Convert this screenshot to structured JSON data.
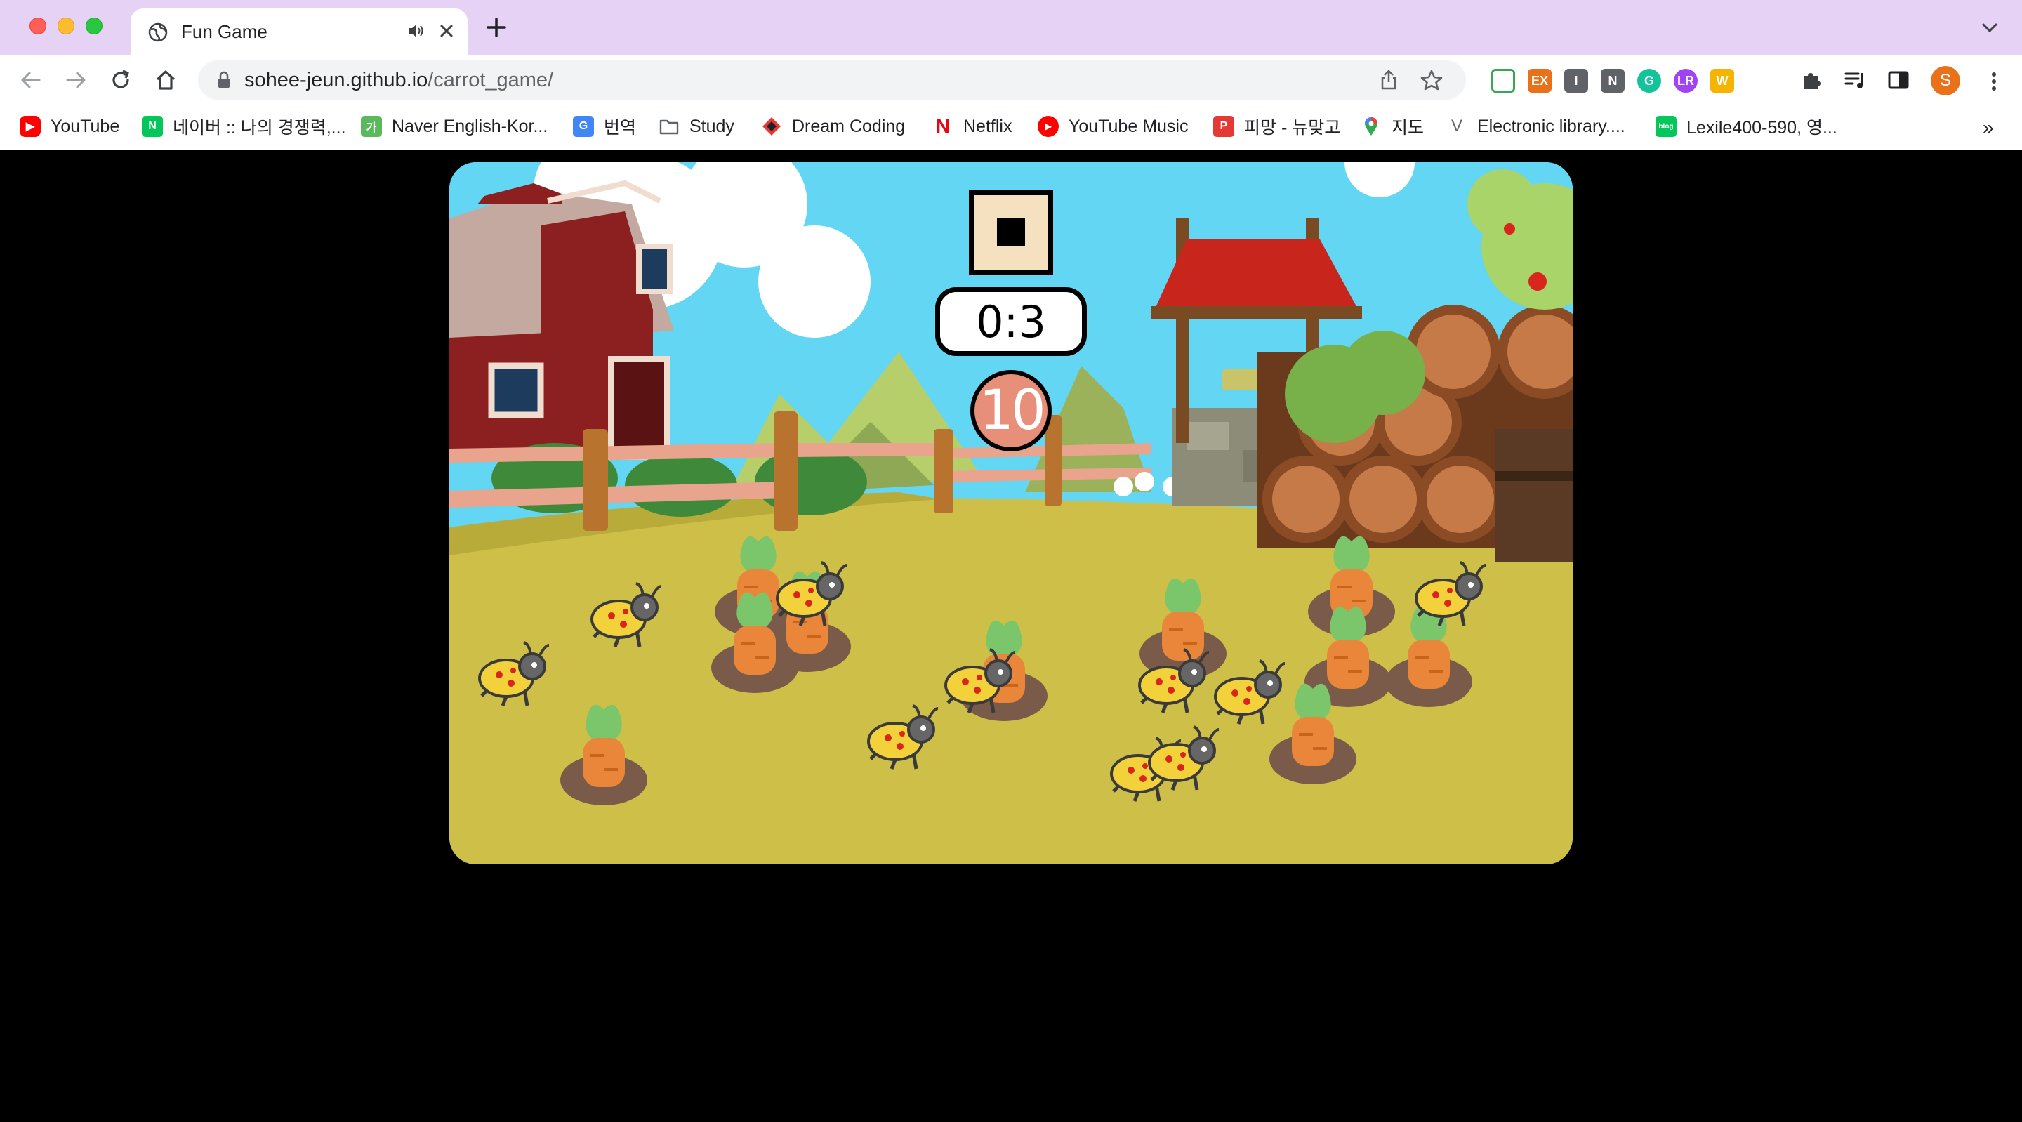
{
  "browser": {
    "tab": {
      "title": "Fun Game"
    },
    "url": {
      "host": "sohee-jeun.github.io",
      "path": "/carrot_game/"
    },
    "bookmarks": [
      {
        "label": "YouTube",
        "icon": "youtube-icon"
      },
      {
        "label": "네이버 :: 나의 경쟁력,...",
        "icon": "naver-icon"
      },
      {
        "label": "Naver English-Kor...",
        "icon": "naver-dictionary-icon"
      },
      {
        "label": "번역",
        "icon": "google-translate-icon"
      },
      {
        "label": "Study",
        "icon": "folder-icon"
      },
      {
        "label": "Dream Coding",
        "icon": "dream-coding-icon"
      },
      {
        "label": "Netflix",
        "icon": "netflix-icon"
      },
      {
        "label": "YouTube Music",
        "icon": "youtube-music-icon"
      },
      {
        "label": "피망 - 뉴맞고",
        "icon": "pmang-icon"
      },
      {
        "label": "지도",
        "icon": "google-maps-icon"
      },
      {
        "label": "Electronic library....",
        "icon": "library-icon"
      },
      {
        "label": "Lexile400-590, 영...",
        "icon": "blog-icon"
      }
    ],
    "more_label": "»",
    "profile_initial": "S",
    "extensions": [
      {
        "name": "extension-monitor-icon",
        "text": "",
        "color": "#34a853"
      },
      {
        "name": "extension-ex-icon",
        "text": "EX",
        "color": "#e8711a"
      },
      {
        "name": "extension-i-icon",
        "text": "I",
        "color": "#5f6368"
      },
      {
        "name": "extension-n-icon",
        "text": "N",
        "color": "#5f6368"
      },
      {
        "name": "extension-grammarly-icon",
        "text": "G",
        "color": "#15c39a"
      },
      {
        "name": "extension-lr-icon",
        "text": "LR",
        "color": "#a142f4"
      },
      {
        "name": "extension-w-icon",
        "text": "W",
        "color": "#f4b400"
      }
    ]
  },
  "game": {
    "timer": "0:3",
    "carrot_count": "10",
    "colors": {
      "sky": "#62d6f2",
      "ground": "#cdbf48",
      "stop_button": "#f5e0c0",
      "counter": "#e88f79",
      "carrot": "#e9863a",
      "bug": "#f2d13a"
    }
  }
}
